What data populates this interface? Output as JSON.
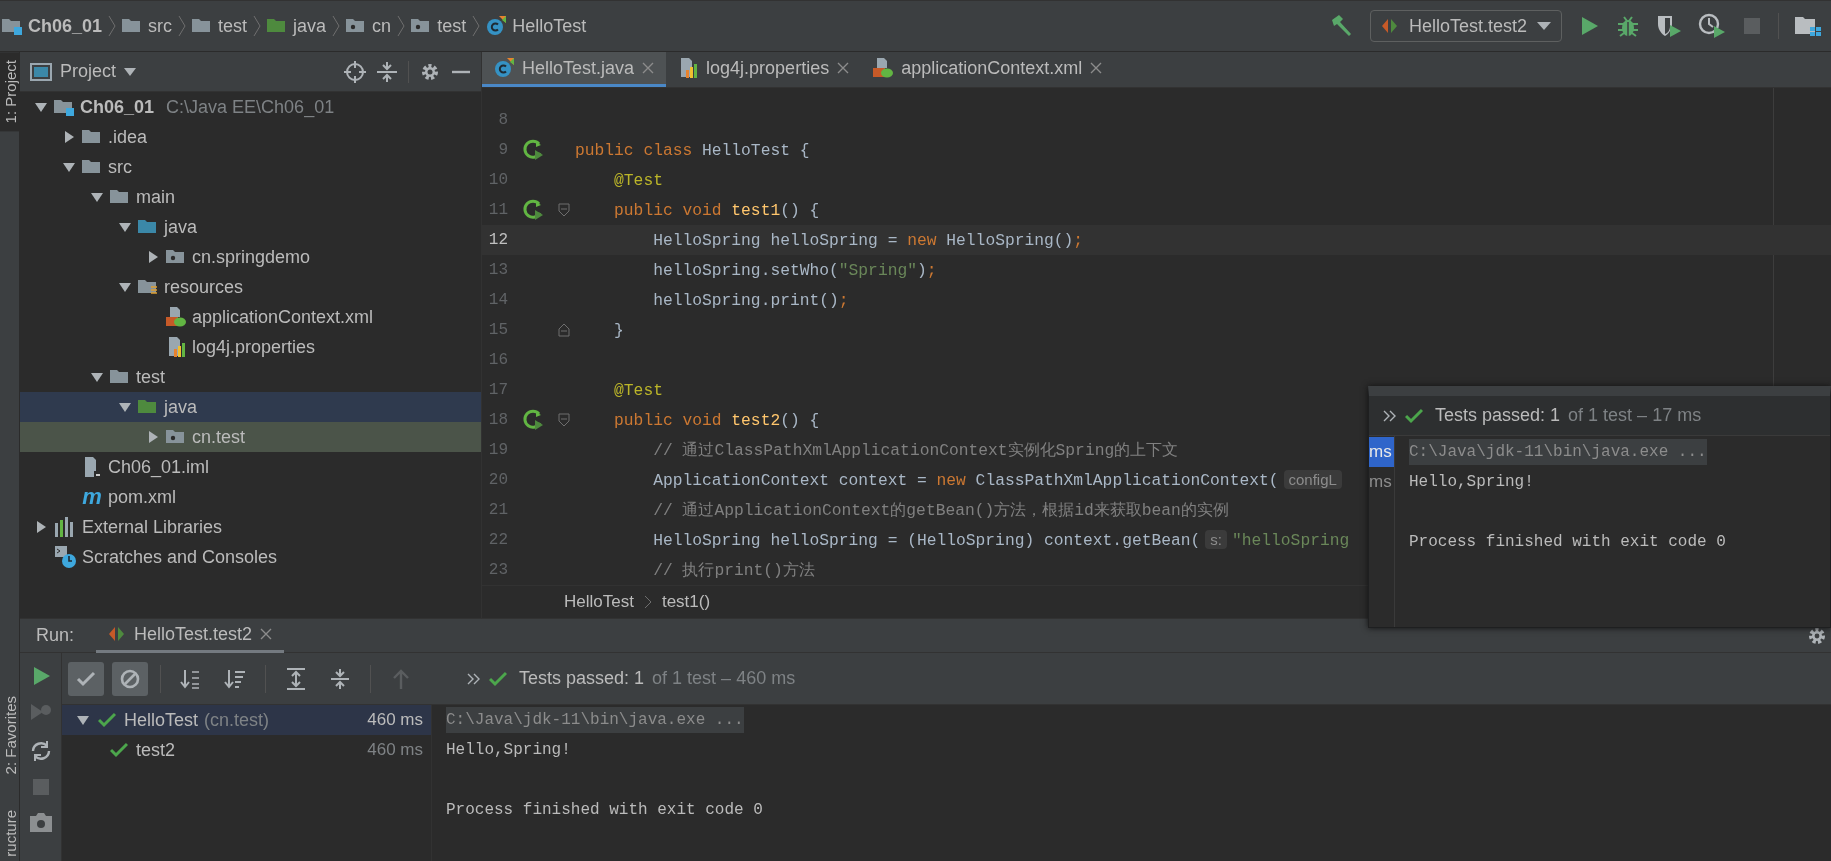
{
  "navbar": {
    "crumbs": [
      {
        "text": "Ch06_01",
        "kind": "module"
      },
      {
        "text": "src",
        "kind": "folder"
      },
      {
        "text": "test",
        "kind": "folder"
      },
      {
        "text": "java",
        "kind": "test-folder"
      },
      {
        "text": "cn",
        "kind": "package"
      },
      {
        "text": "test",
        "kind": "package"
      },
      {
        "text": "HelloTest",
        "kind": "class"
      }
    ],
    "run_config": "HelloTest.test2",
    "actions": [
      {
        "kind": "build",
        "disabled": false
      },
      {
        "kind": "run",
        "disabled": false
      },
      {
        "kind": "debug",
        "disabled": false
      },
      {
        "kind": "coverage",
        "disabled": false
      },
      {
        "kind": "profile",
        "disabled": false
      },
      {
        "kind": "stop",
        "disabled": true
      },
      {
        "kind": "structure",
        "disabled": false
      }
    ]
  },
  "tool_strip": {
    "top": [
      {
        "label": "1: Project",
        "selected": true
      }
    ],
    "bottom": [
      {
        "label": "2: Favorites",
        "selected": false
      },
      {
        "label": "ructure",
        "selected": false
      }
    ]
  },
  "project": {
    "title": "Project",
    "tree": [
      {
        "label": "Ch06_01",
        "path": "C:\\Java EE\\Ch06_01",
        "kind": "module",
        "expanded": true,
        "selected": false,
        "highlighted": false,
        "children": [
          {
            "label": ".idea",
            "kind": "folder",
            "expanded": false,
            "selected": false,
            "highlighted": false
          },
          {
            "label": "src",
            "kind": "folder",
            "expanded": true,
            "selected": false,
            "highlighted": false,
            "children": [
              {
                "label": "main",
                "kind": "folder",
                "expanded": true,
                "selected": false,
                "highlighted": false,
                "children": [
                  {
                    "label": "java",
                    "kind": "source-folder",
                    "expanded": true,
                    "selected": false,
                    "highlighted": false,
                    "children": [
                      {
                        "label": "cn.springdemo",
                        "kind": "package",
                        "expanded": false,
                        "selected": false,
                        "highlighted": false
                      }
                    ]
                  },
                  {
                    "label": "resources",
                    "kind": "resources",
                    "expanded": true,
                    "selected": false,
                    "highlighted": false,
                    "children": [
                      {
                        "label": "applicationContext.xml",
                        "kind": "xml",
                        "selected": false,
                        "highlighted": false
                      },
                      {
                        "label": "log4j.properties",
                        "kind": "properties",
                        "selected": false,
                        "highlighted": false
                      }
                    ]
                  }
                ]
              },
              {
                "label": "test",
                "kind": "folder",
                "expanded": true,
                "selected": false,
                "highlighted": false,
                "children": [
                  {
                    "label": "java",
                    "kind": "test-folder",
                    "expanded": true,
                    "selected": true,
                    "highlighted": false,
                    "children": [
                      {
                        "label": "cn.test",
                        "kind": "package",
                        "expanded": false,
                        "selected": false,
                        "highlighted": true
                      }
                    ]
                  }
                ]
              }
            ]
          },
          {
            "label": "Ch06_01.iml",
            "kind": "iml",
            "selected": false,
            "highlighted": false
          },
          {
            "label": "pom.xml",
            "kind": "maven",
            "badge": "m",
            "selected": false,
            "highlighted": false
          }
        ]
      },
      {
        "label": "External Libraries",
        "kind": "libraries",
        "expanded": false,
        "selected": false,
        "highlighted": false
      },
      {
        "label": "Scratches and Consoles",
        "kind": "scratches",
        "selected": false,
        "highlighted": false
      }
    ]
  },
  "editor": {
    "tabs": [
      {
        "label": "HelloTest.java",
        "kind": "class",
        "selected": true
      },
      {
        "label": "log4j.properties",
        "kind": "properties",
        "selected": false
      },
      {
        "label": "applicationContext.xml",
        "kind": "xml",
        "selected": false
      }
    ],
    "lines": [
      {
        "number": "8",
        "current": false
      },
      {
        "number": "9",
        "current": false,
        "runnable": true,
        "segments": [
          {
            "kind": "keyword",
            "text": "public class "
          },
          {
            "kind": "plain",
            "text": "HelloTest {"
          }
        ]
      },
      {
        "number": "10",
        "current": false,
        "segments": [
          {
            "kind": "annotation",
            "text": "    @Test"
          }
        ]
      },
      {
        "number": "11",
        "current": false,
        "runnable": true,
        "fold_start": true,
        "segments": [
          {
            "kind": "keyword",
            "text": "    public void "
          },
          {
            "kind": "method",
            "text": "test1"
          },
          {
            "kind": "plain",
            "text": "() {"
          }
        ]
      },
      {
        "number": "12",
        "current": true,
        "segments": [
          {
            "kind": "plain",
            "text": "        HelloSpring helloSpring = "
          },
          {
            "kind": "keyword",
            "text": "new "
          },
          {
            "kind": "plain",
            "text": "HelloSpring()"
          },
          {
            "kind": "keyword",
            "text": ";"
          }
        ]
      },
      {
        "number": "13",
        "current": false,
        "segments": [
          {
            "kind": "plain",
            "text": "        helloSpring.setWho("
          },
          {
            "kind": "string",
            "text": "\"Spring\""
          },
          {
            "kind": "plain",
            "text": ")"
          },
          {
            "kind": "keyword",
            "text": ";"
          }
        ]
      },
      {
        "number": "14",
        "current": false,
        "segments": [
          {
            "kind": "plain",
            "text": "        helloSpring.print()"
          },
          {
            "kind": "keyword",
            "text": ";"
          }
        ]
      },
      {
        "number": "15",
        "current": false,
        "fold_end": true,
        "segments": [
          {
            "kind": "plain",
            "text": "    }"
          }
        ]
      },
      {
        "number": "16",
        "current": false
      },
      {
        "number": "17",
        "current": false,
        "segments": [
          {
            "kind": "annotation",
            "text": "    @Test"
          }
        ]
      },
      {
        "number": "18",
        "current": false,
        "runnable": true,
        "fold_start": true,
        "segments": [
          {
            "kind": "keyword",
            "text": "    public void "
          },
          {
            "kind": "method",
            "text": "test2"
          },
          {
            "kind": "plain",
            "text": "() {"
          }
        ]
      },
      {
        "number": "19",
        "current": false,
        "segments": [
          {
            "kind": "comment",
            "text": "        // 通过ClassPathXmlApplicationContext实例化Spring的上下文"
          }
        ]
      },
      {
        "number": "20",
        "current": false,
        "segments": [
          {
            "kind": "plain",
            "text": "        ApplicationContext context = "
          },
          {
            "kind": "keyword",
            "text": "new "
          },
          {
            "kind": "plain",
            "text": "ClassPathXmlApplicationContext("
          },
          {
            "kind": "hint",
            "text": "configL"
          }
        ]
      },
      {
        "number": "21",
        "current": false,
        "segments": [
          {
            "kind": "comment",
            "text": "        // 通过ApplicationContext的getBean()方法，根据id来获取bean的实例"
          }
        ]
      },
      {
        "number": "22",
        "current": false,
        "segments": [
          {
            "kind": "plain",
            "text": "        HelloSpring helloSpring = (HelloSpring) context.getBean("
          },
          {
            "kind": "hint",
            "text": "s:"
          },
          {
            "kind": "string",
            "text": "\"helloSpring"
          }
        ]
      },
      {
        "number": "23",
        "current": false,
        "segments": [
          {
            "kind": "comment",
            "text": "        // 执行print()方法"
          }
        ]
      }
    ],
    "breadcrumb": [
      "HelloTest",
      "test1()"
    ]
  },
  "run": {
    "label": "Run:",
    "tab": {
      "label": "HelloTest.test2",
      "selected": true
    },
    "side": [
      {
        "kind": "run",
        "disabled": false
      },
      {
        "kind": "rerun-failed",
        "disabled": true
      },
      {
        "kind": "auto-test",
        "disabled": false
      },
      {
        "kind": "stop",
        "disabled": true
      },
      {
        "kind": "screenshot",
        "disabled": false
      }
    ],
    "toolbar": [
      {
        "kind": "show-passed",
        "on": true
      },
      {
        "kind": "show-ignored",
        "on": true
      },
      {
        "kind": "sort-alpha",
        "on": false
      },
      {
        "kind": "sort-duration",
        "on": false
      },
      {
        "kind": "expand-all",
        "on": false
      },
      {
        "kind": "collapse-all",
        "on": false
      },
      {
        "kind": "previous",
        "on": false,
        "disabled": true
      }
    ],
    "status": "Tests passed: 1",
    "detail": "of 1 test – 460 ms",
    "tests": [
      {
        "name": "HelloTest",
        "package": "(cn.test)",
        "time": "460 ms",
        "passed": true,
        "selected": true,
        "expanded": true,
        "children": [
          {
            "name": "test2",
            "time": "460 ms",
            "passed": true,
            "selected": false
          }
        ]
      }
    ],
    "console": [
      {
        "kind": "command",
        "text": "C:\\Java\\jdk-11\\bin\\java.exe ..."
      },
      {
        "kind": "output",
        "text": "Hello,Spring!"
      },
      {
        "kind": "blank"
      },
      {
        "kind": "output",
        "text": "Process finished with exit code 0"
      }
    ]
  },
  "popup": {
    "status": "Tests passed: 1",
    "detail": "of 1 test – 17 ms",
    "fragments": [
      {
        "text": "ms",
        "selected": true
      },
      {
        "text": "ms",
        "selected": false
      }
    ],
    "console": [
      {
        "kind": "command",
        "text": "C:\\Java\\jdk-11\\bin\\java.exe ..."
      },
      {
        "kind": "output",
        "text": "Hello,Spring!"
      },
      {
        "kind": "blank"
      },
      {
        "kind": "output",
        "text": "Process finished with exit code 0"
      }
    ]
  }
}
